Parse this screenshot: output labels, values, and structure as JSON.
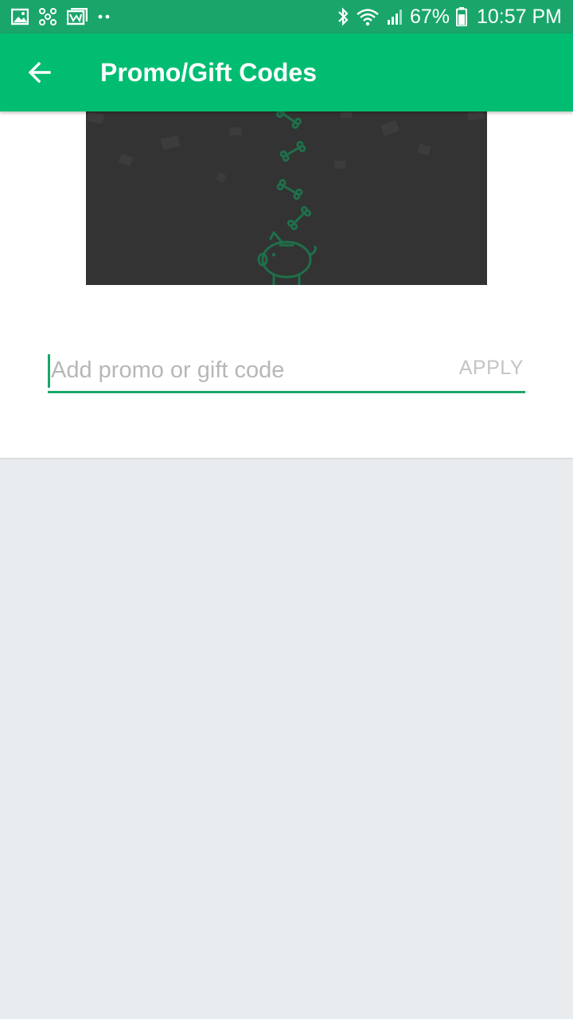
{
  "status_bar": {
    "left_icons": [
      "gallery-icon",
      "fan-icon",
      "mail-icon",
      "more-dots-icon"
    ],
    "right_icons": [
      "bluetooth-icon",
      "wifi-icon",
      "signal-icon",
      "battery-icon"
    ],
    "battery": "67%",
    "time": "10:57 PM"
  },
  "app_bar": {
    "title": "Promo/Gift Codes",
    "back_icon": "arrow-left-icon"
  },
  "promo": {
    "input_value": "",
    "placeholder": "Add promo or gift code",
    "apply_label": "APPLY"
  },
  "colors": {
    "status_bar": "#1aa66b",
    "app_bar": "#00bd72",
    "accent": "#1aa66b",
    "illustration_bg": "#333333",
    "page_bg": "#e8ecee"
  }
}
